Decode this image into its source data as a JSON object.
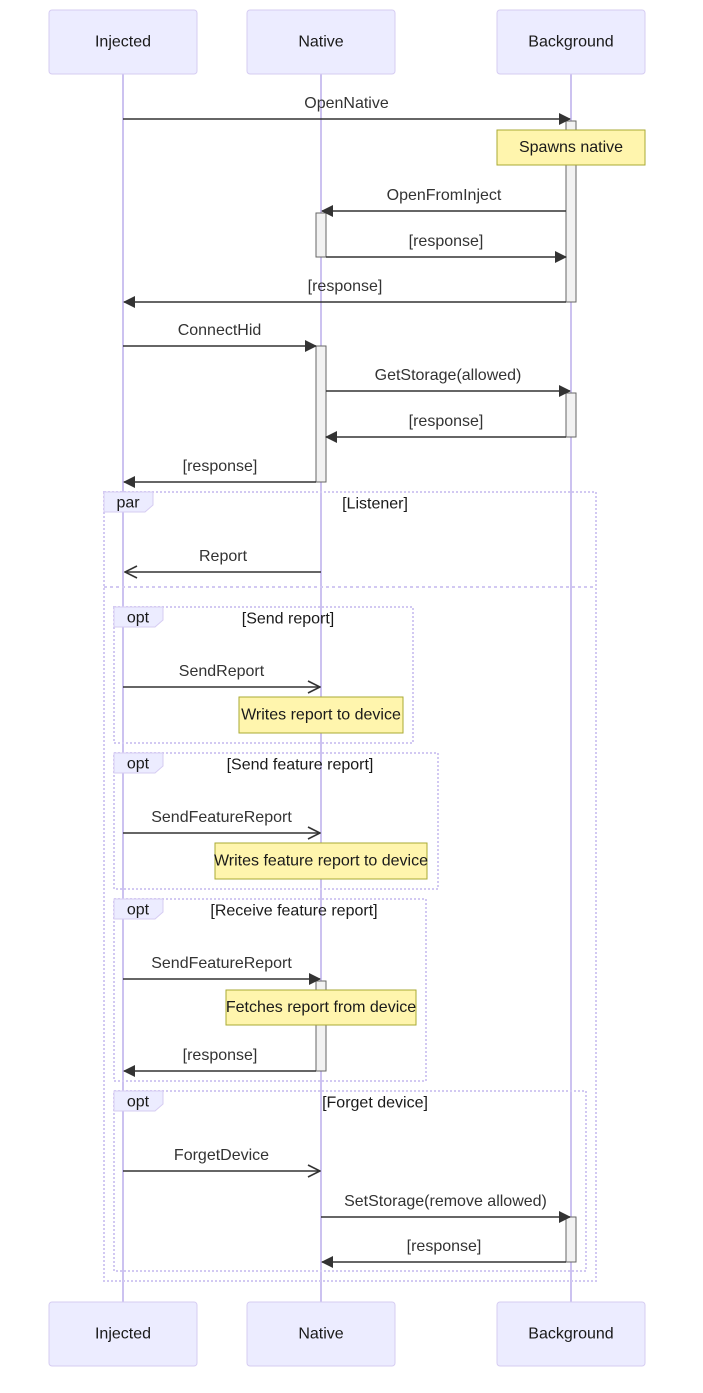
{
  "diagram": {
    "type": "sequence",
    "colors": {
      "actor_fill": "#ECECFF",
      "actor_border": "#d6ccf2",
      "lifeline": "#ccc2f0",
      "message": "#333333",
      "note_fill": "#fff5ad",
      "note_border": "#aaaa33",
      "activation_fill": "#f2f2f2"
    },
    "participants": [
      {
        "id": "injected",
        "label": "Injected"
      },
      {
        "id": "native",
        "label": "Native"
      },
      {
        "id": "background",
        "label": "Background"
      }
    ],
    "messages": [
      {
        "id": "m1",
        "from": "injected",
        "to": "background",
        "label": "OpenNative",
        "arrow": "solid"
      },
      {
        "id": "m2",
        "from": "background",
        "to": "native",
        "label": "OpenFromInject",
        "arrow": "solid"
      },
      {
        "id": "m3",
        "from": "native",
        "to": "background",
        "label": "[response]",
        "arrow": "solid"
      },
      {
        "id": "m4",
        "from": "background",
        "to": "injected",
        "label": "[response]",
        "arrow": "solid"
      },
      {
        "id": "m5",
        "from": "injected",
        "to": "native",
        "label": "ConnectHid",
        "arrow": "solid"
      },
      {
        "id": "m6",
        "from": "native",
        "to": "background",
        "label": "GetStorage(allowed)",
        "arrow": "solid"
      },
      {
        "id": "m7",
        "from": "background",
        "to": "native",
        "label": "[response]",
        "arrow": "solid"
      },
      {
        "id": "m8",
        "from": "native",
        "to": "injected",
        "label": "[response]",
        "arrow": "solid"
      },
      {
        "id": "m9",
        "from": "native",
        "to": "injected",
        "label": "Report",
        "arrow": "open"
      },
      {
        "id": "m10",
        "from": "injected",
        "to": "native",
        "label": "SendReport",
        "arrow": "open"
      },
      {
        "id": "m11",
        "from": "injected",
        "to": "native",
        "label": "SendFeatureReport",
        "arrow": "open"
      },
      {
        "id": "m12",
        "from": "injected",
        "to": "native",
        "label": "SendFeatureReport",
        "arrow": "solid"
      },
      {
        "id": "m13",
        "from": "native",
        "to": "injected",
        "label": "[response]",
        "arrow": "solid"
      },
      {
        "id": "m14",
        "from": "injected",
        "to": "native",
        "label": "ForgetDevice",
        "arrow": "open"
      },
      {
        "id": "m15",
        "from": "native",
        "to": "background",
        "label": "SetStorage(remove allowed)",
        "arrow": "solid"
      },
      {
        "id": "m16",
        "from": "background",
        "to": "native",
        "label": "[response]",
        "arrow": "solid"
      }
    ],
    "notes": [
      {
        "id": "n1",
        "over": "background",
        "label": "Spawns native"
      },
      {
        "id": "n2",
        "over": "native",
        "label": "Writes report to device"
      },
      {
        "id": "n3",
        "over": "native",
        "label": "Writes feature report to device"
      },
      {
        "id": "n4",
        "over": "native",
        "label": "Fetches report from device"
      }
    ],
    "blocks": [
      {
        "id": "par",
        "kind": "par",
        "condition": "[Listener]"
      },
      {
        "id": "opt1",
        "kind": "opt",
        "condition": "[Send report]"
      },
      {
        "id": "opt2",
        "kind": "opt",
        "condition": "[Send feature report]"
      },
      {
        "id": "opt3",
        "kind": "opt",
        "condition": "[Receive feature report]"
      },
      {
        "id": "opt4",
        "kind": "opt",
        "condition": "[Forget device]"
      }
    ]
  }
}
